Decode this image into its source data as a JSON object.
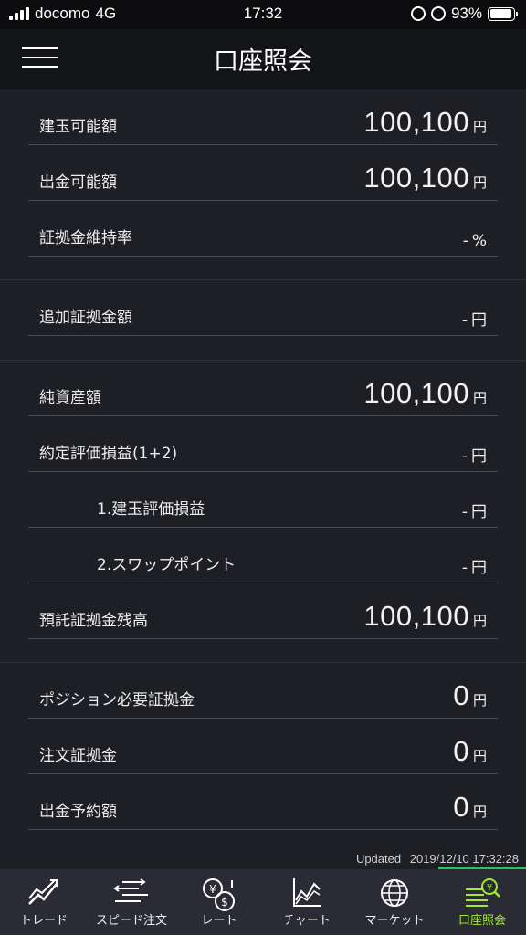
{
  "status_bar": {
    "carrier": "docomo",
    "network": "4G",
    "time": "17:32",
    "battery": "93%"
  },
  "header": {
    "title": "口座照会"
  },
  "sections": [
    {
      "rows": [
        {
          "label": "建玉可能額",
          "value": "100,100",
          "unit": "円"
        },
        {
          "label": "出金可能額",
          "value": "100,100",
          "unit": "円"
        },
        {
          "label": "証拠金維持率",
          "value": "-",
          "unit": "%"
        }
      ]
    },
    {
      "rows": [
        {
          "label": "追加証拠金額",
          "value": "-",
          "unit": "円"
        }
      ]
    },
    {
      "rows": [
        {
          "label": "純資産額",
          "value": "100,100",
          "unit": "円"
        },
        {
          "label": "約定評価損益(1+2)",
          "value": "-",
          "unit": "円"
        },
        {
          "label": "1.建玉評価損益",
          "value": "-",
          "unit": "円"
        },
        {
          "label": "2.スワップポイント",
          "value": "-",
          "unit": "円"
        },
        {
          "label": "預託証拠金残高",
          "value": "100,100",
          "unit": "円"
        }
      ]
    },
    {
      "rows": [
        {
          "label": "ポジション必要証拠金",
          "value": "0",
          "unit": "円"
        },
        {
          "label": "注文証拠金",
          "value": "0",
          "unit": "円"
        },
        {
          "label": "出金予約額",
          "value": "0",
          "unit": "円"
        }
      ]
    }
  ],
  "updated": {
    "label": "Updated",
    "timestamp": "2019/12/10 17:32:28"
  },
  "tabs": [
    {
      "label": "トレード",
      "icon": "trade-chart-icon"
    },
    {
      "label": "スピード注文",
      "icon": "speed-order-icon"
    },
    {
      "label": "レート",
      "icon": "rate-currency-icon"
    },
    {
      "label": "チャート",
      "icon": "chart-icon"
    },
    {
      "label": "マーケット",
      "icon": "globe-icon"
    },
    {
      "label": "口座照会",
      "icon": "account-inquiry-icon",
      "active": true
    }
  ],
  "colors": {
    "background": "#1e1f24",
    "header": "#131418",
    "tab_bar": "#2a2b34",
    "active_tab": "#a3e635"
  }
}
